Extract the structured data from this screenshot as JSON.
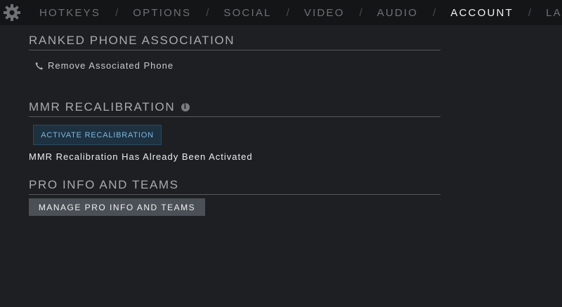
{
  "nav": {
    "tabs": [
      {
        "label": "HOTKEYS",
        "active": false
      },
      {
        "label": "OPTIONS",
        "active": false
      },
      {
        "label": "SOCIAL",
        "active": false
      },
      {
        "label": "VIDEO",
        "active": false
      },
      {
        "label": "AUDIO",
        "active": false
      },
      {
        "label": "ACCOUNT",
        "active": true
      },
      {
        "label": "LABS",
        "active": false
      }
    ],
    "separator": "/",
    "settings_icon": "gear-icon"
  },
  "phone_section": {
    "title": "RANKED PHONE ASSOCIATION",
    "remove_link": "Remove Associated Phone",
    "icon": "phone-icon"
  },
  "mmr_section": {
    "title": "MMR RECALIBRATION",
    "info_icon": "info-icon",
    "info_glyph": "i",
    "activate_label": "ACTIVATE RECALIBRATION",
    "status": "MMR Recalibration Has Already Been Activated"
  },
  "pro_section": {
    "title": "PRO INFO AND TEAMS",
    "manage_label": "MANAGE PRO INFO AND TEAMS"
  },
  "colors": {
    "background": "#1e1f22",
    "topbar": "#141517",
    "active_tab": "#f2f2f2",
    "inactive_tab": "#6e7074",
    "accent_button": "#1d3141",
    "accent_text": "#7fb7dd",
    "manage_button": "#4a5056"
  }
}
